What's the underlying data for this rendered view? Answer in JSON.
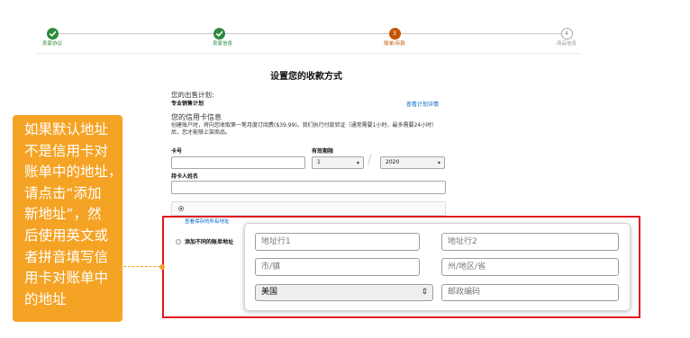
{
  "stepper": {
    "steps": [
      {
        "label": "卖家协议",
        "state": "done",
        "icon": "check-icon"
      },
      {
        "label": "卖家信息",
        "state": "done",
        "icon": "check-icon"
      },
      {
        "number": "3",
        "label": "账单/存款",
        "state": "current"
      },
      {
        "number": "4",
        "label": "商品信息",
        "state": "pending"
      }
    ]
  },
  "page_title": "设置您的收款方式",
  "plan": {
    "heading": "您的出售计划:",
    "name": "专业销售计划",
    "details_link": "查看计划详情"
  },
  "card": {
    "heading": "您的信用卡信息",
    "note_lines": [
      "创建账户时，将向您收取第一笔月度订阅费($39.99)。我们执行付款验证（通常需要1小时，最多需要24小时）",
      "后，您才能够上架商品。"
    ],
    "number_label": "卡号",
    "expiry_label": "有效期限",
    "expiry_month": "1",
    "expiry_separator": "/",
    "expiry_year": "2020",
    "select_arrow_icon": "select-arrow-icon",
    "holder_label": "持卡人姓名"
  },
  "address": {
    "saved_address_selected": true,
    "view_saved_link": "查看保存的所有地址",
    "add_different_label": "添加不同的账单地址",
    "line1_placeholder": "地址行1",
    "line2_placeholder": "地址行2",
    "city_placeholder": "市/镇",
    "state_placeholder": "州/地区/省",
    "country": "美国",
    "country_arrow": "⇕",
    "postal_placeholder": "邮政编码"
  },
  "callout": {
    "lines": [
      "如果默认地址",
      "不是信用卡对",
      "账单中的地址，",
      "请点击“添加",
      "新地址”，然",
      "后使用英文或",
      "者拼音填写信",
      "用卡对账单中",
      "的地址"
    ]
  },
  "colors": {
    "step_done": "#2d8a3e",
    "step_current": "#c45500",
    "step_pending": "#9a9a9a",
    "link": "#0066c0",
    "callout": "#f5a325",
    "highlight_box": "#e0191f"
  }
}
